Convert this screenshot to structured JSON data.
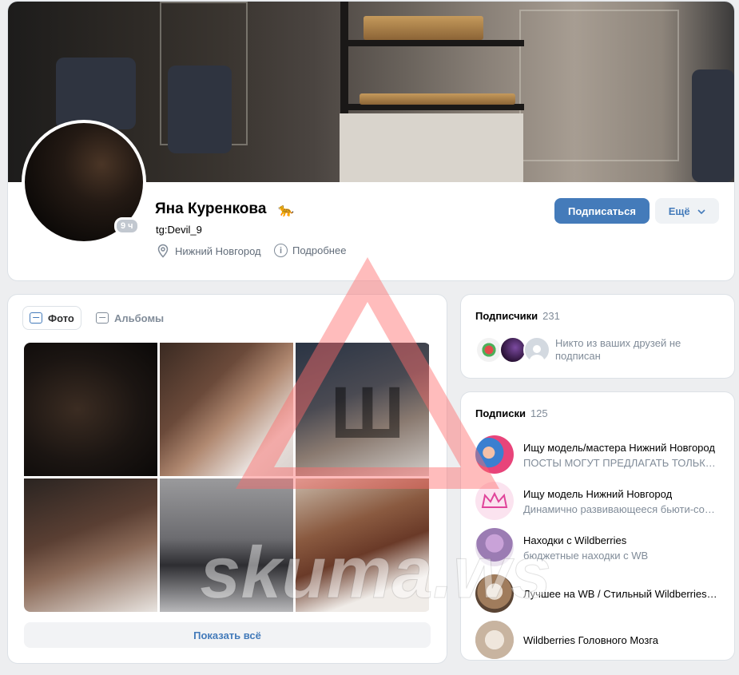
{
  "profile": {
    "name": "Яна Куренкова",
    "name_emoji": "🐆",
    "status": "tg:Devil_9",
    "online_badge": "9 ч",
    "location": "Нижний Новгород",
    "details_link": "Подробнее",
    "subscribe_button": "Подписаться",
    "more_button": "Ещё"
  },
  "photos": {
    "tabs": [
      {
        "label": "Фото",
        "active": true
      },
      {
        "label": "Альбомы",
        "active": false
      }
    ],
    "show_all": "Показать всё"
  },
  "followers": {
    "title": "Подписчики",
    "count": "231",
    "note": "Никто из ваших друзей не подписан"
  },
  "subscriptions": {
    "title": "Подписки",
    "count": "125",
    "items": [
      {
        "title": "Ищу модель/мастера Нижний Новгород",
        "desc": "ПОСТЫ МОГУТ ПРЕДЛАГАТЬ ТОЛЬКО УЧАСТНИКИ"
      },
      {
        "title": "Ищу модель Нижний Новгород",
        "desc": "Динамично развивающееся бьюти-сообщество"
      },
      {
        "title": "Находки с Wildberries",
        "desc": "бюджетные находки с WB"
      },
      {
        "title": "Лучшее на WB / Стильный Wildberries Обзор",
        "desc": ""
      },
      {
        "title": "Wildberries Головного Мозга",
        "desc": ""
      }
    ]
  },
  "watermark": {
    "text": "skuma.ws",
    "letter": "Ш"
  },
  "colors": {
    "accent": "#447bba",
    "watermark": "#ff6b6b"
  }
}
